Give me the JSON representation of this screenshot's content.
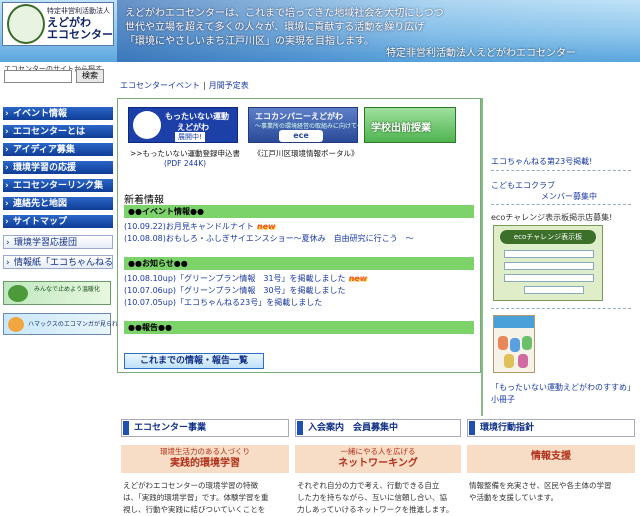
{
  "header": {
    "logo_small": "特定非営利活動法人",
    "logo_big_1": "えどがわ",
    "logo_big_2": "エコセンター",
    "line1": "えどがわエコセンターは、これまで培ってきた地域社会を大切にしつつ",
    "line2": "世代や立場を超えて多くの人々が、環境に貢献する活動を繰り広げ",
    "line3": "「環境にやさしいまち江戸川区」の実現を目指します。",
    "org": "特定非営利活動法人えどがわエコセンター"
  },
  "search": {
    "note": "エコセンターのサイトから探す",
    "button": "検索",
    "value": ""
  },
  "nav": {
    "items": [
      {
        "label": "イベント情報"
      },
      {
        "label": "エコセンターとは"
      },
      {
        "label": "アイディア募集"
      },
      {
        "label": "環境学習の応援"
      },
      {
        "label": "エコセンターリンク集"
      },
      {
        "label": "連絡先と地図"
      },
      {
        "label": "サイトマップ"
      },
      {
        "label": "環境学習応援団"
      },
      {
        "label": "情報紙「エコちゃんねる」"
      }
    ],
    "banner1": "みんなで止めよう温暖化",
    "banner2": "ハマックスのエコマンガが見られるよ!"
  },
  "breadcrumb": {
    "link1": "エコセンターイベント",
    "sep": "|",
    "link2": "月間予定表"
  },
  "main": {
    "banner_mottainai_1": "もったいない運動",
    "banner_mottainai_2": "えどがわ",
    "banner_mottainai_3": "展開中!",
    "banner_ece_1": "エコカンパニーえどがわ",
    "banner_ece_2": "〜事業所の環境経営の取組みに向けて〜",
    "banner_ece_logo": "ece",
    "banner_school": "学校出前授業",
    "caption1": ">>もったいない運動登録申込書",
    "caption1_pdf": "(PDF 244K)",
    "caption2": "《江戸川区環境情報ポータル》",
    "news_title": "新着情報",
    "events_header": "●●イベント情報●●",
    "events": [
      {
        "date": "(10.09.22)",
        "text": "お月見キャンドルナイト",
        "new": "new"
      },
      {
        "date": "(10.08.08)",
        "text": "おもしろ・ふしぎサイエンスショー〜夏休み　自由研究に行こう　〜",
        "new": ""
      }
    ],
    "notices_header": "●●お知らせ●●",
    "notices": [
      {
        "date": "(10.08.10up)",
        "text": "「グリーンプラン情報　31号」を掲載しました",
        "new": "new"
      },
      {
        "date": "(10.07.06up)",
        "text": "「グリーンプラン情報　30号」を掲載しました",
        "new": ""
      },
      {
        "date": "(10.07.05up)",
        "text": "「エコちゃんねる23号」を掲載しました",
        "new": ""
      }
    ],
    "reports_header": "●●報告●●",
    "archive_button": "これまでの情報・報告一覧"
  },
  "right": {
    "link1": "エコちゃんねる第23号掲載!",
    "link2": "こどもエコクラブ",
    "link3": "メンバー募集中",
    "eco_label": "ecoチャレンジ表示板掲示店募集!",
    "card_head": "ecoチャレンジ表示板",
    "booklet_link": "「もったいない運動えどがわのすすめ」",
    "booklet_link2": "小冊子"
  },
  "sections": [
    {
      "title": "エコセンター事業",
      "sub1": "環境生活力のある人づくり",
      "sub2": "実践的環境学習",
      "text1": "えどがわエコセンターの環境学習の特徴",
      "text2": "は、「実践的環境学習」です。体験学習を重",
      "text3": "視し、行動や実践に結びついていくことを"
    },
    {
      "title": "入会案内　会員募集中",
      "sub1": "一緒にやる人を広げる",
      "sub2": "ネットワーキング",
      "text1": "それぞれ自分の力で考え、行動できる自立",
      "text2": "した力を持ちながら、互いに信頼し合い、協",
      "text3": "力しあっていけるネットワークを推進します。"
    },
    {
      "title": "環境行動指針",
      "sub1": "",
      "sub2": "情報支援",
      "text1": "情報整備を充実させ、区民や各主体の学習",
      "text2": "や活動を支援しています。",
      "text3": ""
    }
  ]
}
